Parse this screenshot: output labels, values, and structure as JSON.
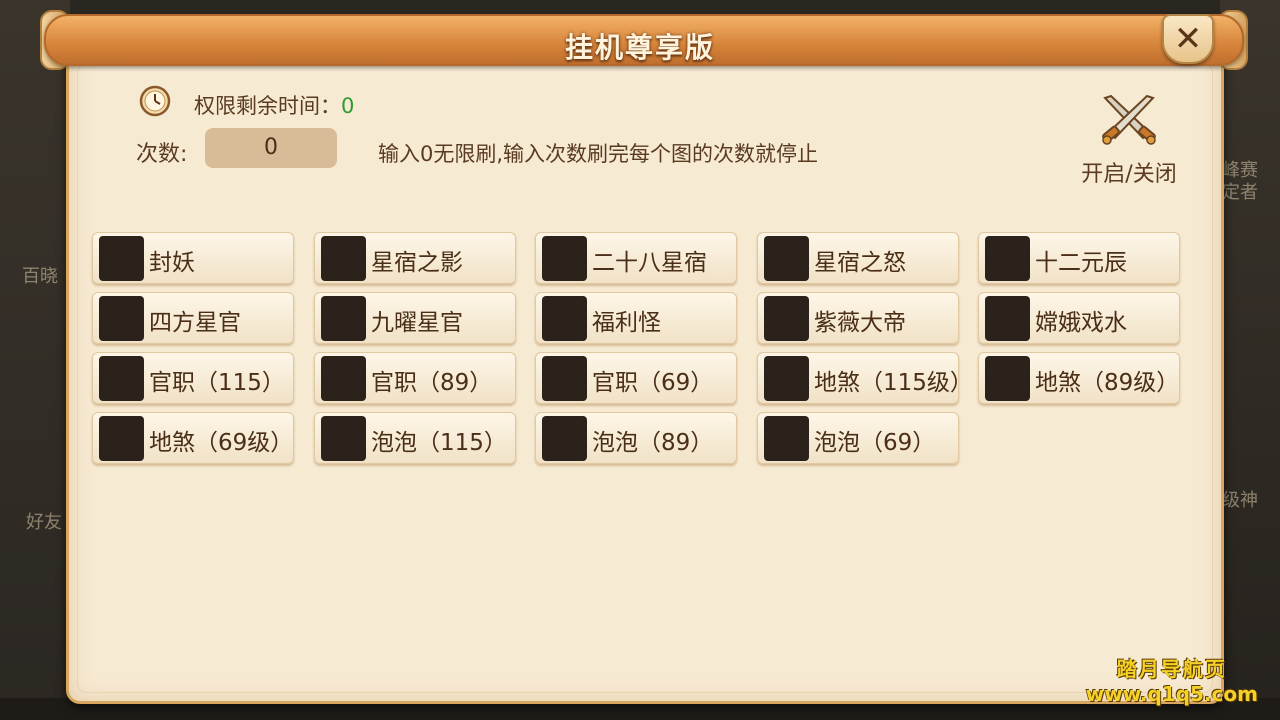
{
  "dialog": {
    "title": "挂机尊享版",
    "close_symbol": "✕"
  },
  "timer": {
    "label": "权限剩余时间：",
    "value": "0"
  },
  "count": {
    "label": "次数:",
    "value": "0"
  },
  "hint": "输入0无限刷,输入次数刷完每个图的次数就停止",
  "toggle": {
    "label": "开启/关闭",
    "icon": "crossed-swords-icon"
  },
  "items": [
    {
      "label": "封妖"
    },
    {
      "label": "星宿之影"
    },
    {
      "label": "二十八星宿"
    },
    {
      "label": "星宿之怒"
    },
    {
      "label": "十二元辰"
    },
    {
      "label": "四方星官"
    },
    {
      "label": "九曜星官"
    },
    {
      "label": "福利怪"
    },
    {
      "label": "紫薇大帝"
    },
    {
      "label": "嫦娥戏水"
    },
    {
      "label": "官职（115）"
    },
    {
      "label": "官职（89）"
    },
    {
      "label": "官职（69）"
    },
    {
      "label": "地煞（115级）"
    },
    {
      "label": "地煞（89级）"
    },
    {
      "label": "地煞（69级）"
    },
    {
      "label": "泡泡（115）"
    },
    {
      "label": "泡泡（89）"
    },
    {
      "label": "泡泡（69）"
    }
  ],
  "background": {
    "left_texts": [
      "百晓",
      "好友"
    ],
    "right_texts": [
      "峰赛",
      "定者",
      "级神"
    ]
  },
  "watermark": {
    "line1": "踏月导航页",
    "line2": "www.q1q5.com"
  },
  "colors": {
    "panel_bg": "#f7ead3",
    "titlebar": "#d6843a",
    "timer_value": "#2f9b2f",
    "checkbox": "#2b231b",
    "watermark": "#f5d027"
  }
}
